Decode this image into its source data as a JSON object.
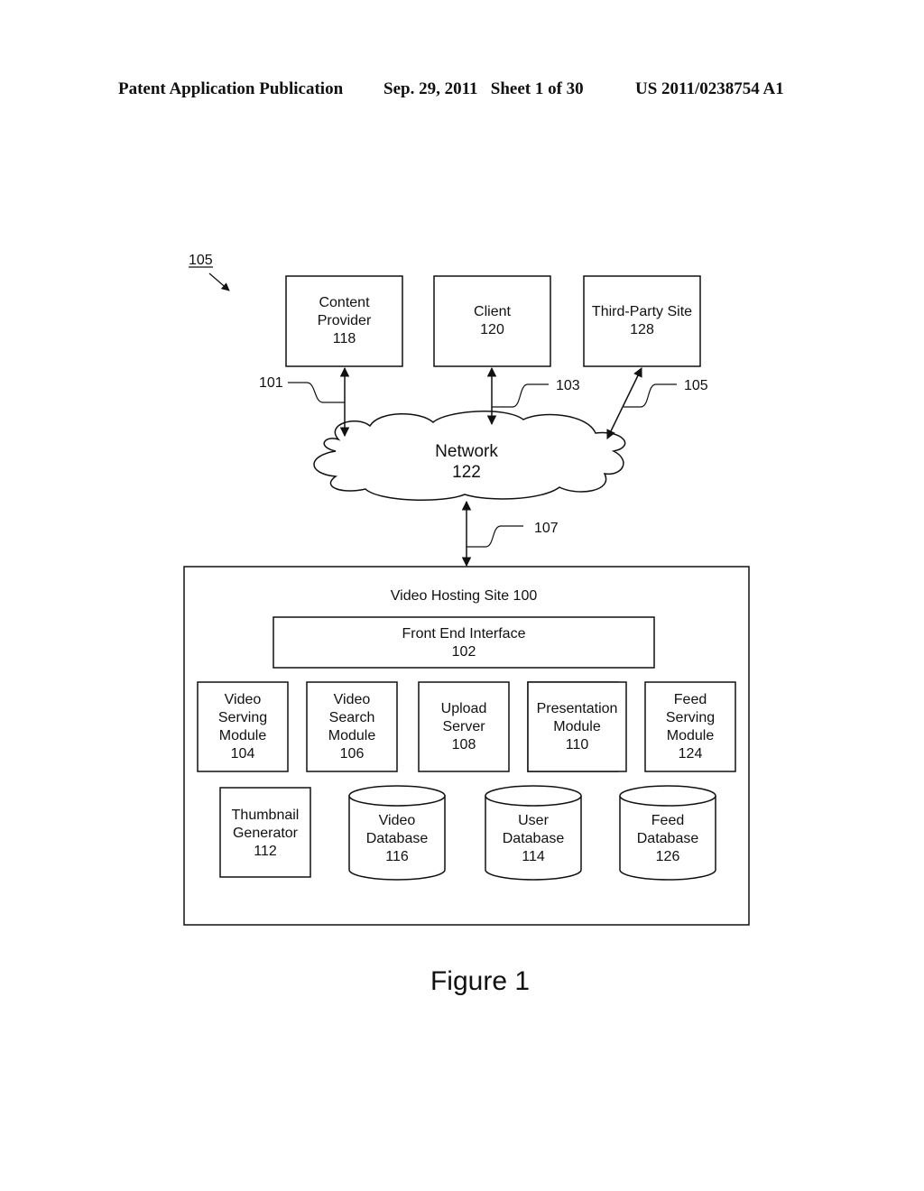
{
  "header": {
    "left": "Patent Application Publication",
    "date_sheet": "Sep. 29, 2011   Sheet 1 of 30",
    "number": "US 2011/0238754 A1"
  },
  "diagram": {
    "system_ref": "105",
    "top_boxes": [
      {
        "id": "content-provider",
        "lines": [
          "Content",
          "Provider",
          "118"
        ]
      },
      {
        "id": "client",
        "lines": [
          "Client",
          "120"
        ]
      },
      {
        "id": "third-party-site",
        "lines": [
          "Third-Party Site",
          "128"
        ]
      }
    ],
    "link_labels": {
      "l101": "101",
      "l103": "103",
      "l105": "105",
      "l107": "107"
    },
    "network": {
      "lines": [
        "Network",
        "122"
      ]
    },
    "hosting_site": {
      "title": "Video Hosting Site 100",
      "front_end": {
        "lines": [
          "Front End Interface",
          "102"
        ]
      },
      "modules": [
        {
          "id": "video-serving-module",
          "lines": [
            "Video",
            "Serving",
            "Module",
            "104"
          ]
        },
        {
          "id": "video-search-module",
          "lines": [
            "Video",
            "Search",
            "Module",
            "106"
          ]
        },
        {
          "id": "upload-server",
          "lines": [
            "Upload",
            "Server",
            "108"
          ]
        },
        {
          "id": "presentation-module",
          "lines": [
            "Presentation",
            "Module",
            "110"
          ]
        },
        {
          "id": "feed-serving-module",
          "lines": [
            "Feed",
            "Serving",
            "Module",
            "124"
          ]
        }
      ],
      "thumbnail": {
        "lines": [
          "Thumbnail",
          "Generator",
          "112"
        ]
      },
      "databases": [
        {
          "id": "video-database",
          "lines": [
            "Video",
            "Database",
            "116"
          ]
        },
        {
          "id": "user-database",
          "lines": [
            "User",
            "Database",
            "114"
          ]
        },
        {
          "id": "feed-database",
          "lines": [
            "Feed",
            "Database",
            "126"
          ]
        }
      ]
    },
    "caption": "Figure 1"
  }
}
